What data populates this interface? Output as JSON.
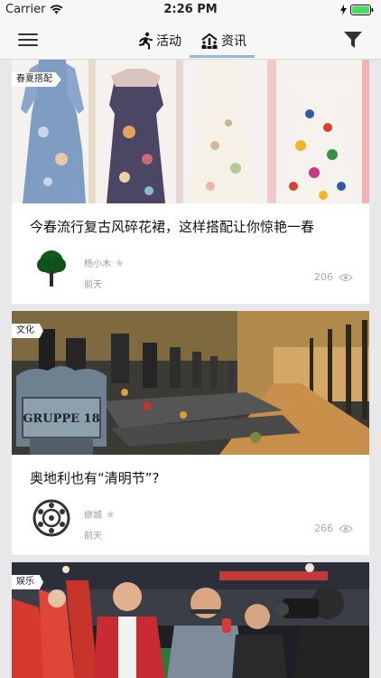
{
  "status_bar": {
    "carrier": "Carrier",
    "time": "2:26 PM"
  },
  "nav": {
    "menu_icon": "menu-icon",
    "tabs": [
      {
        "label": "活动",
        "icon": "running-person-icon",
        "active": false
      },
      {
        "label": "资讯",
        "icon": "info-people-icon",
        "active": true
      }
    ],
    "filter_icon": "filter-icon",
    "accent_color": "#8fbbd9"
  },
  "feed": [
    {
      "tag": "春夏搭配",
      "title": "今春流行复古风碎花裙，这样搭配让你惊艳一春",
      "author": "杨小木",
      "date": "前天",
      "views": "206",
      "image": "floral-dresses"
    },
    {
      "tag": "文化",
      "title": "奥地利也有“清明节”?",
      "author": "继城",
      "date": "前天",
      "views": "266",
      "image": "cemetery-gruppe-18",
      "image_text": "GRUPPE 18"
    },
    {
      "tag": "娱乐",
      "image": "sports-interview"
    }
  ]
}
